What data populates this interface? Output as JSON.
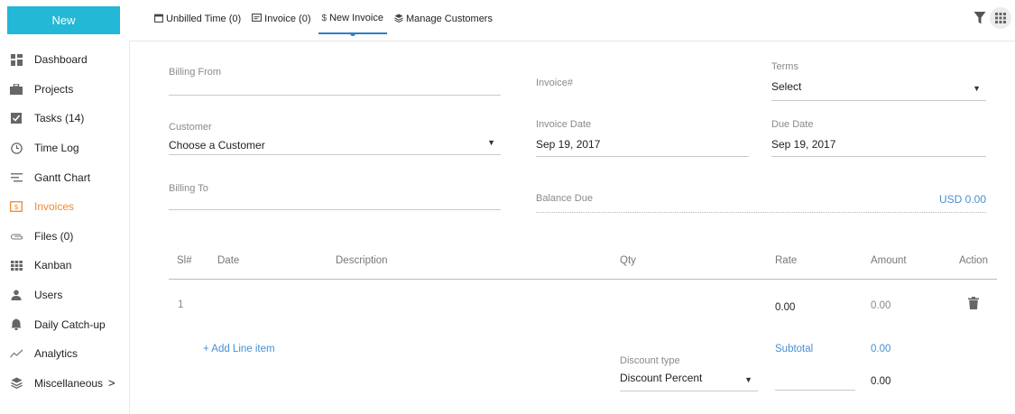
{
  "sidebar": {
    "new_button": "New",
    "items": [
      {
        "label": "Dashboard",
        "icon": "dashboard-icon"
      },
      {
        "label": "Projects",
        "icon": "briefcase-icon"
      },
      {
        "label": "Tasks (14)",
        "icon": "checkbox-icon"
      },
      {
        "label": "Time Log",
        "icon": "clock-icon"
      },
      {
        "label": "Gantt Chart",
        "icon": "gantt-icon"
      },
      {
        "label": "Invoices",
        "icon": "invoice-icon",
        "active": true
      },
      {
        "label": "Files  (0)",
        "icon": "paperclip-icon"
      },
      {
        "label": "Kanban",
        "icon": "kanban-icon"
      },
      {
        "label": "Users",
        "icon": "user-icon"
      },
      {
        "label": "Daily Catch-up",
        "icon": "bell-icon"
      },
      {
        "label": "Analytics",
        "icon": "analytics-icon"
      },
      {
        "label": "Miscellaneous",
        "icon": "layers-icon",
        "chevron": ">"
      }
    ],
    "active_color": "#f08a2b"
  },
  "topbar": {
    "tabs": [
      {
        "label": "Unbilled Time (0)",
        "icon": "calendar-icon"
      },
      {
        "label": "Invoice (0)",
        "icon": "invoice-icon"
      },
      {
        "label": "New Invoice",
        "icon": "dollar-icon",
        "active": true
      },
      {
        "label": "Manage Customers",
        "icon": "customers-icon"
      }
    ]
  },
  "form": {
    "billing_from": {
      "label": "Billing From",
      "value": ""
    },
    "invoice_no": {
      "label": "Invoice#",
      "value": ""
    },
    "terms": {
      "label": "Terms",
      "value": "Select"
    },
    "customer": {
      "label": "Customer",
      "value": "Choose a Customer"
    },
    "invoice_date": {
      "label": "Invoice Date",
      "value": "Sep 19, 2017"
    },
    "due_date": {
      "label": "Due Date",
      "value": "Sep 19, 2017"
    },
    "billing_to": {
      "label": "Billing To",
      "value": ""
    },
    "balance_due": {
      "label": "Balance Due",
      "value": "USD 0.00"
    }
  },
  "table": {
    "headers": {
      "sl": "Sl#",
      "date": "Date",
      "description": "Description",
      "qty": "Qty",
      "rate": "Rate",
      "amount": "Amount",
      "action": "Action"
    },
    "rows": [
      {
        "sl": "1",
        "date": "",
        "description": "",
        "qty": "",
        "rate": "0.00",
        "amount": "0.00"
      }
    ],
    "add_line_item": "+ Add Line item",
    "subtotal_label": "Subtotal",
    "subtotal_value": "0.00",
    "discount_type_label": "Discount type",
    "discount_type_value": "Discount Percent",
    "discount_input": "",
    "discount_value": "0.00"
  },
  "colors": {
    "brand": "#22b8d6",
    "link": "#4a8fd0",
    "accent": "#f08a2b"
  }
}
